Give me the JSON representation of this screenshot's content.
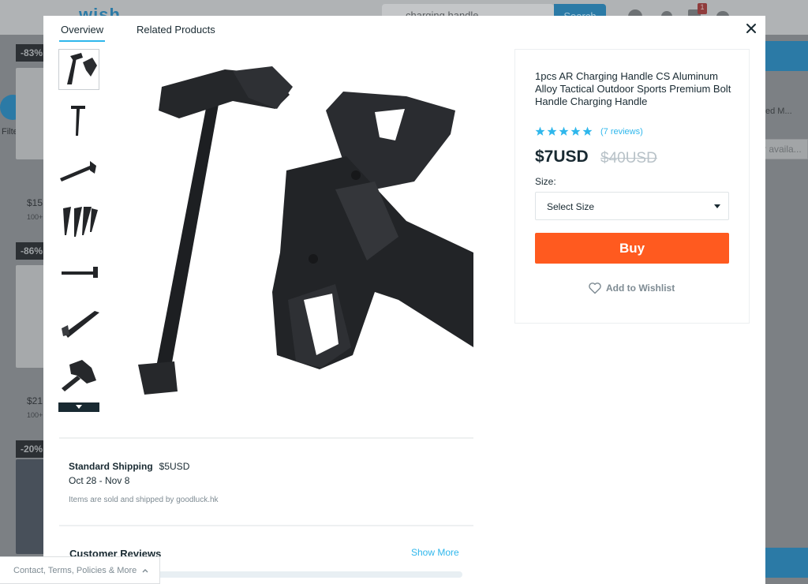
{
  "background": {
    "logo": "wish",
    "search_text": "charging handle",
    "search_button": "Search",
    "cart_count": "1",
    "filter_label": "Filter",
    "cards": [
      {
        "discount": "-83%",
        "price": "$15",
        "sub": "100+"
      },
      {
        "discount": "-86%",
        "price": "$21",
        "sub": "100+"
      },
      {
        "discount": "-20%"
      }
    ],
    "right_text": "ed M...",
    "right_box": "r availa..."
  },
  "tabs": [
    {
      "label": "Overview",
      "active": true
    },
    {
      "label": "Related Products",
      "active": false
    }
  ],
  "product": {
    "title": "1pcs AR Charging Handle CS Aluminum Alloy Tactical Outdoor Sports Premium Bolt Handle Charging Handle",
    "rating": 5,
    "review_count_label": "(7 reviews)",
    "price": "$7USD",
    "original_price": "$40USD",
    "size_label": "Size:",
    "size_placeholder": "Select Size",
    "buy_label": "Buy",
    "wishlist_label": "Add to Wishlist",
    "accent_color": "#2fb7ec",
    "buy_color": "#ff5a1f"
  },
  "shipping": {
    "title": "Standard Shipping",
    "price": "$5USD",
    "dates": "Oct 28 - Nov 8",
    "seller": "Items are sold and shipped by goodluck.hk"
  },
  "reviews": {
    "title": "Customer Reviews",
    "show_more": "Show More"
  },
  "footer": {
    "link": "Contact, Terms, Policies & More"
  }
}
